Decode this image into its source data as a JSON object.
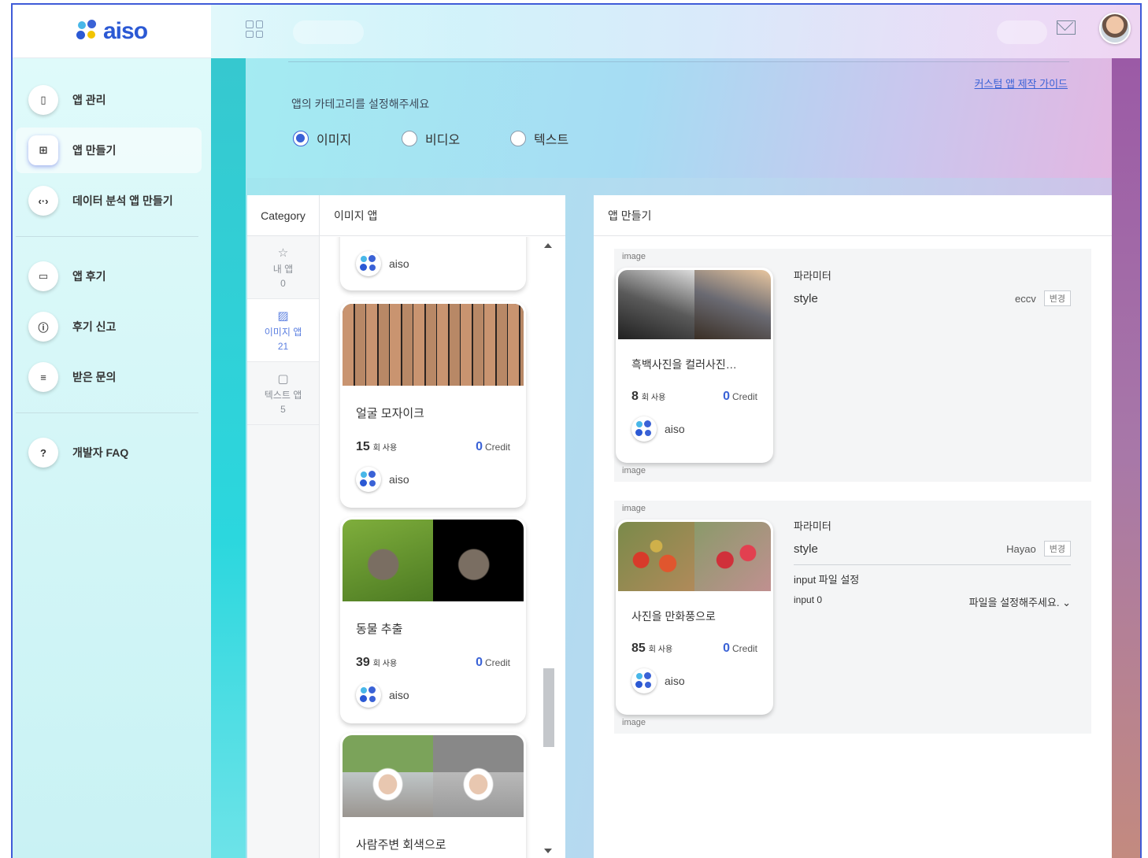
{
  "brand": {
    "name": "aiso"
  },
  "sidebar": {
    "items": [
      {
        "label": "앱 관리",
        "icon": "vibrate-icon"
      },
      {
        "label": "앱 만들기",
        "icon": "add-image-icon",
        "active": true
      },
      {
        "label": "데이터 분석 앱 만들기",
        "icon": "code-icon"
      },
      {
        "label": "앱 후기",
        "icon": "chat-icon"
      },
      {
        "label": "후기 신고",
        "icon": "alert-icon"
      },
      {
        "label": "받은 문의",
        "icon": "message-icon"
      },
      {
        "label": "개발자 FAQ",
        "icon": "help-icon"
      }
    ]
  },
  "category_section": {
    "title": "앱의 카테고리를 설정해주세요",
    "guide_link": "커스텀 앱 제작 가이드",
    "options": [
      {
        "label": "이미지",
        "selected": true
      },
      {
        "label": "비디오",
        "selected": false
      },
      {
        "label": "텍스트",
        "selected": false
      }
    ]
  },
  "left_panel": {
    "category_header": "Category",
    "list_header": "이미지 앱",
    "categories": [
      {
        "label": "내 앱",
        "count": "0",
        "icon": "star-icon"
      },
      {
        "label": "이미지 앱",
        "count": "21",
        "icon": "image-icon",
        "selected": true
      },
      {
        "label": "텍스트 앱",
        "count": "5",
        "icon": "document-icon"
      }
    ],
    "apps": [
      {
        "owner": "aiso"
      },
      {
        "name": "얼굴 모자이크",
        "uses": "15",
        "uses_unit": "회 사용",
        "credit": "0",
        "credit_unit": "Credit",
        "owner": "aiso"
      },
      {
        "name": "동물 추출",
        "uses": "39",
        "uses_unit": "회 사용",
        "credit": "0",
        "credit_unit": "Credit",
        "owner": "aiso"
      },
      {
        "name": "사람주변 회색으로"
      }
    ]
  },
  "right_panel": {
    "header": "앱 만들기",
    "blocks": [
      {
        "top_label": "image",
        "bottom_label": "image",
        "card": {
          "name": "흑백사진을 컬러사진…",
          "uses": "8",
          "uses_unit": "회 사용",
          "credit": "0",
          "credit_unit": "Credit",
          "owner": "aiso"
        },
        "param_title": "파라미터",
        "param_name": "style",
        "param_value": "eccv",
        "change_label": "변경"
      },
      {
        "top_label": "image",
        "bottom_label": "image",
        "card": {
          "name": "사진을 만화풍으로",
          "uses": "85",
          "uses_unit": "회 사용",
          "credit": "0",
          "credit_unit": "Credit",
          "owner": "aiso"
        },
        "param_title": "파라미터",
        "param_name": "style",
        "param_value": "Hayao",
        "change_label": "변경",
        "input_title": "input 파일 설정",
        "input_name": "input 0",
        "input_select": "파일을 설정해주세요."
      }
    ]
  }
}
